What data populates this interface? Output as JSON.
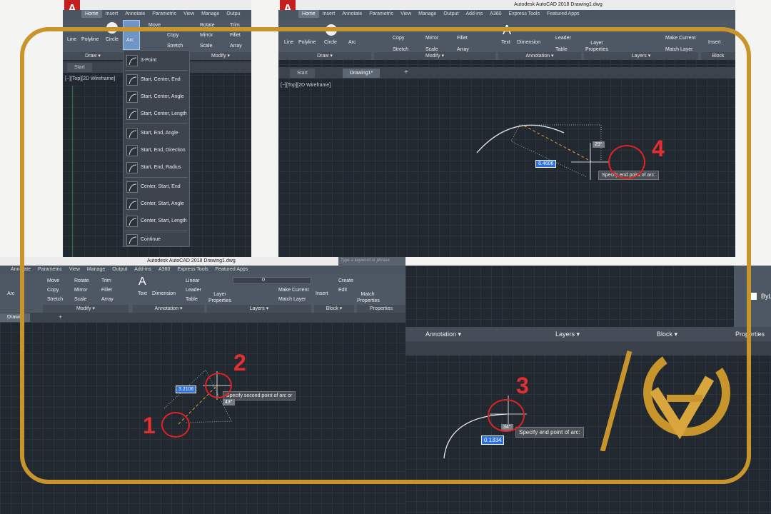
{
  "app_title": "Autodesk AutoCAD 2018  Drawing1.dwg",
  "shot_a": {
    "tabs": [
      "Home",
      "Insert",
      "Annotate",
      "Parametric",
      "View",
      "Manage",
      "Outpu"
    ],
    "draw_tools": [
      "Line",
      "Polyline",
      "Circle",
      "Arc"
    ],
    "modify_tools": {
      "move": "Move",
      "copy": "Copy",
      "stretch": "Stretch",
      "rotate": "Rotate",
      "mirror": "Mirror",
      "scale": "Scale",
      "trim": "Trim",
      "fillet": "Fillet",
      "array": "Array"
    },
    "panel_draw": "Draw",
    "panel_modify": "Modify",
    "start_tab": "Start",
    "viewport_label": "[−][Top][2D Wireframe]",
    "arc_menu": [
      "3-Point",
      "Start, Center, End",
      "Start, Center, Angle",
      "Start, Center, Length",
      "Start, End, Angle",
      "Start, End, Direction",
      "Start, End, Radius",
      "Center, Start, End",
      "Center, Start, Angle",
      "Center, Start, Length",
      "Continue"
    ]
  },
  "shot_b": {
    "title": "Autodesk AutoCAD 2018   Drawing1.dwg",
    "tabs": [
      "Home",
      "Insert",
      "Annotate",
      "Parametric",
      "View",
      "Manage",
      "Output",
      "Add-ins",
      "A360",
      "Express Tools",
      "Featured Apps"
    ],
    "tools": {
      "line": "Line",
      "polyline": "Polyline",
      "circle": "Circle",
      "arc": "Arc",
      "copy": "Copy",
      "stretch": "Stretch",
      "mirror": "Mirror",
      "scale": "Scale",
      "fillet": "Fillet",
      "array": "Array",
      "text": "Text",
      "dimension": "Dimension",
      "leader": "Leader",
      "table": "Table",
      "layer_properties": "Layer Properties",
      "make_current": "Make Current",
      "match_layer": "Match Layer",
      "insert": "Insert"
    },
    "panels": {
      "draw": "Draw",
      "modify": "Modify",
      "annotation": "Annotation",
      "layers": "Layers",
      "block": "Block"
    },
    "doc_tabs": [
      "Start",
      "Drawing1*"
    ],
    "viewport_label": "[−][Top][2D Wireframe]",
    "dyn_value": "6.4606",
    "angle": "29°",
    "tooltip": "Specify end point of arc:",
    "marker": "4"
  },
  "shot_c": {
    "title": "Autodesk AutoCAD 2018   Drawing1.dwg",
    "search_placeholder": "Type a keyword or phrase",
    "tabs": [
      "Annotate",
      "Parametric",
      "View",
      "Manage",
      "Output",
      "Add-ins",
      "A360",
      "Express Tools",
      "Featured Apps"
    ],
    "tools": {
      "arc": "Arc",
      "move": "Move",
      "copy": "Copy",
      "stretch": "Stretch",
      "rotate": "Rotate",
      "mirror": "Mirror",
      "scale": "Scale",
      "trim": "Trim",
      "fillet": "Fillet",
      "array": "Array",
      "text": "Text",
      "dimension": "Dimension",
      "linear": "Linear",
      "leader": "Leader",
      "table": "Table",
      "layer_properties": "Layer Properties",
      "make_current": "Make Current",
      "match_layer": "Match Layer",
      "insert": "Insert",
      "create": "Create",
      "edit": "Edit",
      "match_properties": "Match Properties",
      "layer_value": "0"
    },
    "panels": {
      "modify": "Modify",
      "annotation": "Annotation",
      "layers": "Layers",
      "block": "Block",
      "properties": "Properties"
    },
    "doc_tab": "Drawin",
    "dyn_value": "3.2106",
    "angle": "43°",
    "tooltip": "Specify second point of arc or",
    "markers": [
      "1",
      "2"
    ]
  },
  "shot_d": {
    "panels": {
      "annotation": "Annotation",
      "layers": "Layers",
      "block": "Block",
      "properties": "Properties"
    },
    "side_text": "ByL",
    "dyn_value": "0.1334",
    "angle": "34°",
    "tooltip": "Specify end point of arc:",
    "marker": "3"
  },
  "logo_icon": "sv-monogram-logo",
  "colors": {
    "accent_gold": "#c8952c",
    "marker_red": "#e22222",
    "canvas": "#212830"
  }
}
